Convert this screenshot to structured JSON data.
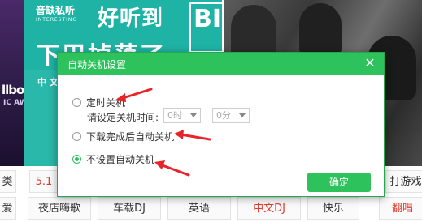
{
  "banner": {
    "brand": "音缺私听",
    "brand_sub": "INTERESTING",
    "headline": "好听到",
    "headline2": "下巴掉落了",
    "cn_mini": "中 文",
    "big": "BIG",
    "left_text": "llboo",
    "left_sub": "IC AWA"
  },
  "categories": {
    "row1": [
      {
        "label": "类",
        "color": "#333333"
      },
      {
        "label": "5.1",
        "color": "#e03b2e"
      },
      {
        "label": "打游戏",
        "color": "#333333"
      }
    ],
    "row2": [
      {
        "label": "爱",
        "color": "#333333"
      },
      {
        "label": "夜店嗨歌",
        "color": "#333333"
      },
      {
        "label": "车载DJ",
        "color": "#333333"
      },
      {
        "label": "英语",
        "color": "#333333"
      },
      {
        "label": "中文DJ",
        "color": "#e03b2e"
      },
      {
        "label": "快乐",
        "color": "#333333"
      },
      {
        "label": "翻唱",
        "color": "#e03b2e"
      }
    ]
  },
  "dialog": {
    "title": "自动关机设置",
    "close_glyph": "✕",
    "options": [
      {
        "label": "定时关机",
        "checked": false
      },
      {
        "label": "下载完成后自动关机",
        "checked": false
      },
      {
        "label": "不设置自动关机",
        "checked": true
      }
    ],
    "time_label": "请设定关机时间:",
    "hour_value": "0时",
    "minute_value": "0分",
    "confirm_label": "确定"
  },
  "colors": {
    "accent": "#2dc25c",
    "arrow": "#e8232a",
    "teal": "#1fb3a5",
    "red_text": "#e03b2e"
  }
}
